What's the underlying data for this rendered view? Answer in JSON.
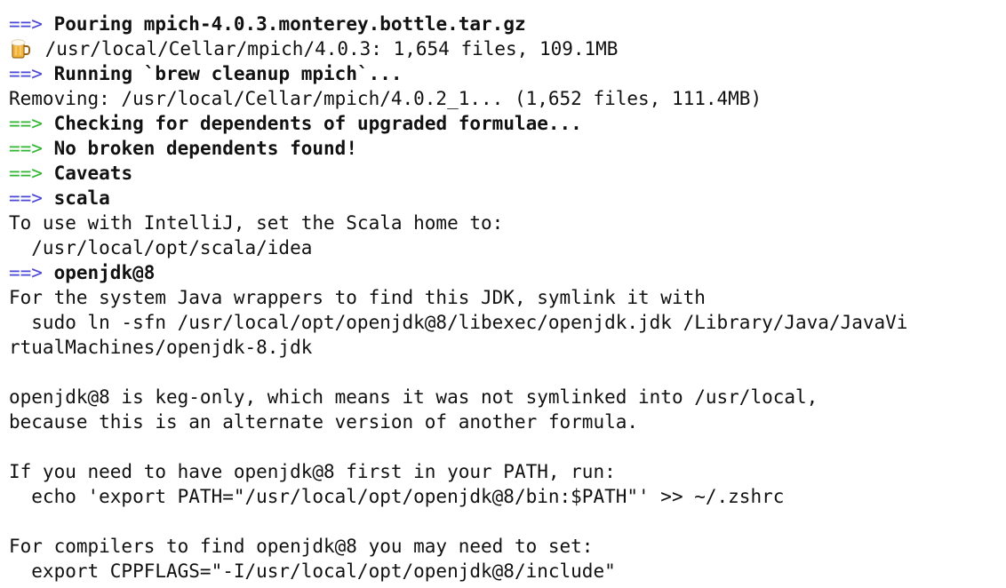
{
  "terminal": {
    "lines": [
      {
        "prefix": "==>",
        "prefix_color": "#4b47d6",
        "text": "Pouring mpich-4.0.3.monterey.bottle.tar.gz",
        "bold": true
      },
      {
        "icon": "beer-mug-icon",
        "text": "/usr/local/Cellar/mpich/4.0.3: 1,654 files, 109.1MB"
      },
      {
        "prefix": "==>",
        "prefix_color": "#4b47d6",
        "text": "Running `brew cleanup mpich`...",
        "bold": true
      },
      {
        "text": "Removing: /usr/local/Cellar/mpich/4.0.2_1... (1,652 files, 111.4MB)"
      },
      {
        "prefix": "==>",
        "prefix_color": "#2fb52f",
        "text": "Checking for dependents of upgraded formulae...",
        "bold": true
      },
      {
        "prefix": "==>",
        "prefix_color": "#2fb52f",
        "text": "No broken dependents found!",
        "bold": true
      },
      {
        "prefix": "==>",
        "prefix_color": "#2fb52f",
        "text": "Caveats",
        "bold": true
      },
      {
        "prefix": "==>",
        "prefix_color": "#4b47d6",
        "text": "scala",
        "bold": true
      },
      {
        "text": "To use with IntelliJ, set the Scala home to:"
      },
      {
        "text": "  /usr/local/opt/scala/idea"
      },
      {
        "prefix": "==>",
        "prefix_color": "#4b47d6",
        "text": "openjdk@8",
        "bold": true
      },
      {
        "text": "For the system Java wrappers to find this JDK, symlink it with"
      },
      {
        "text": "  sudo ln -sfn /usr/local/opt/openjdk@8/libexec/openjdk.jdk /Library/Java/JavaVi"
      },
      {
        "text": "rtualMachines/openjdk-8.jdk"
      },
      {
        "text": ""
      },
      {
        "text": "openjdk@8 is keg-only, which means it was not symlinked into /usr/local,"
      },
      {
        "text": "because this is an alternate version of another formula."
      },
      {
        "text": ""
      },
      {
        "text": "If you need to have openjdk@8 first in your PATH, run:"
      },
      {
        "text": "  echo 'export PATH=\"/usr/local/opt/openjdk@8/bin:$PATH\"' >> ~/.zshrc"
      },
      {
        "text": ""
      },
      {
        "text": "For compilers to find openjdk@8 you may need to set:"
      },
      {
        "text": "  export CPPFLAGS=\"-I/usr/local/opt/openjdk@8/include\""
      }
    ]
  }
}
